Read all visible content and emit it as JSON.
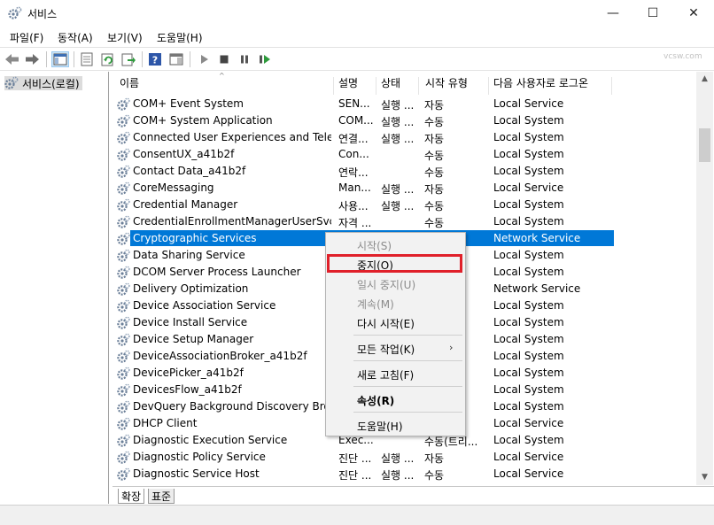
{
  "window": {
    "title": "서비스",
    "minimize": "—",
    "maximize": "☐",
    "close": "✕"
  },
  "menu": [
    "파일(F)",
    "동작(A)",
    "보기(V)",
    "도움말(H)"
  ],
  "toolbar": {
    "icons": [
      "back-arrow-icon",
      "forward-arrow-icon",
      "console-tree-icon",
      "properties-icon",
      "refresh-icon",
      "export-list-icon",
      "help-icon",
      "show-action-pane-icon",
      "start-service-icon",
      "stop-service-icon",
      "pause-service-icon",
      "restart-service-icon"
    ],
    "watermark": "vcsw.com"
  },
  "tree": {
    "root_label": "서비스(로컬)"
  },
  "columns": [
    "이름",
    "설명",
    "상태",
    "시작 유형",
    "다음 사용자로 로그온"
  ],
  "rows": [
    {
      "name": "COM+ Event System",
      "desc": "SEN...",
      "status": "실행 ...",
      "stype": "자동",
      "logon": "Local Service"
    },
    {
      "name": "COM+ System Application",
      "desc": "COM...",
      "status": "실행 ...",
      "stype": "수동",
      "logon": "Local System"
    },
    {
      "name": "Connected User Experiences and Telem...",
      "desc": "연결...",
      "status": "실행 ...",
      "stype": "자동",
      "logon": "Local System"
    },
    {
      "name": "ConsentUX_a41b2f",
      "desc": "Con...",
      "status": "",
      "stype": "수동",
      "logon": "Local System"
    },
    {
      "name": "Contact Data_a41b2f",
      "desc": "연락...",
      "status": "",
      "stype": "수동",
      "logon": "Local System"
    },
    {
      "name": "CoreMessaging",
      "desc": "Man...",
      "status": "실행 ...",
      "stype": "자동",
      "logon": "Local Service"
    },
    {
      "name": "Credential Manager",
      "desc": "사용...",
      "status": "실행 ...",
      "stype": "수동",
      "logon": "Local System"
    },
    {
      "name": "CredentialEnrollmentManagerUserSvc_a...",
      "desc": "자격 ...",
      "status": "",
      "stype": "수동",
      "logon": "Local System"
    },
    {
      "name": "Cryptographic Services",
      "desc": "",
      "status": "",
      "stype": "",
      "logon": "Network Service"
    },
    {
      "name": "Data Sharing Service",
      "desc": "",
      "status": "",
      "stype": "",
      "logon": "Local System"
    },
    {
      "name": "DCOM Server Process Launcher",
      "desc": "",
      "status": "",
      "stype": "",
      "logon": "Local System"
    },
    {
      "name": "Delivery Optimization",
      "desc": "",
      "status": "",
      "stype": "",
      "logon": "Network Service"
    },
    {
      "name": "Device Association Service",
      "desc": "",
      "status": "",
      "stype": "",
      "logon": "Local System"
    },
    {
      "name": "Device Install Service",
      "desc": "",
      "status": "",
      "stype": "",
      "logon": "Local System"
    },
    {
      "name": "Device Setup Manager",
      "desc": "",
      "status": "",
      "stype": "",
      "logon": "Local System"
    },
    {
      "name": "DeviceAssociationBroker_a41b2f",
      "desc": "",
      "status": "",
      "stype": "",
      "logon": "Local System"
    },
    {
      "name": "DevicePicker_a41b2f",
      "desc": "",
      "status": "",
      "stype": "",
      "logon": "Local System"
    },
    {
      "name": "DevicesFlow_a41b2f",
      "desc": "",
      "status": "",
      "stype": "",
      "logon": "Local System"
    },
    {
      "name": "DevQuery Background Discovery Broker",
      "desc": "",
      "status": "",
      "stype": "",
      "logon": "Local System"
    },
    {
      "name": "DHCP Client",
      "desc": "",
      "status": "",
      "stype": "",
      "logon": "Local Service"
    },
    {
      "name": "Diagnostic Execution Service",
      "desc": "Exec...",
      "status": "",
      "stype": "수동(트리...",
      "logon": "Local System"
    },
    {
      "name": "Diagnostic Policy Service",
      "desc": "진단 ...",
      "status": "실행 ...",
      "stype": "자동",
      "logon": "Local Service"
    },
    {
      "name": "Diagnostic Service Host",
      "desc": "진단 ...",
      "status": "실행 ...",
      "stype": "수동",
      "logon": "Local Service"
    }
  ],
  "selected_row_index": 8,
  "context_menu": [
    {
      "label": "시작(S)",
      "disabled": true
    },
    {
      "label": "중지(O)",
      "disabled": false,
      "highlighted": true
    },
    {
      "label": "일시 중지(U)",
      "disabled": true
    },
    {
      "label": "계속(M)",
      "disabled": true
    },
    {
      "label": "다시 시작(E)",
      "disabled": false
    },
    {
      "label": "모든 작업(K)",
      "disabled": false,
      "submenu": true
    },
    {
      "label": "새로 고침(F)",
      "disabled": false
    },
    {
      "label": "속성(R)",
      "disabled": false,
      "bold": true
    },
    {
      "label": "도움말(H)",
      "disabled": false
    }
  ],
  "submenu_arrow": "›",
  "tabs": [
    "확장",
    "표준"
  ],
  "scroll": {
    "up": "▲",
    "down": "▼"
  },
  "sort_indicator": "^",
  "colors": {
    "selection": "#0078d7",
    "highlight_box": "#e0202a"
  }
}
